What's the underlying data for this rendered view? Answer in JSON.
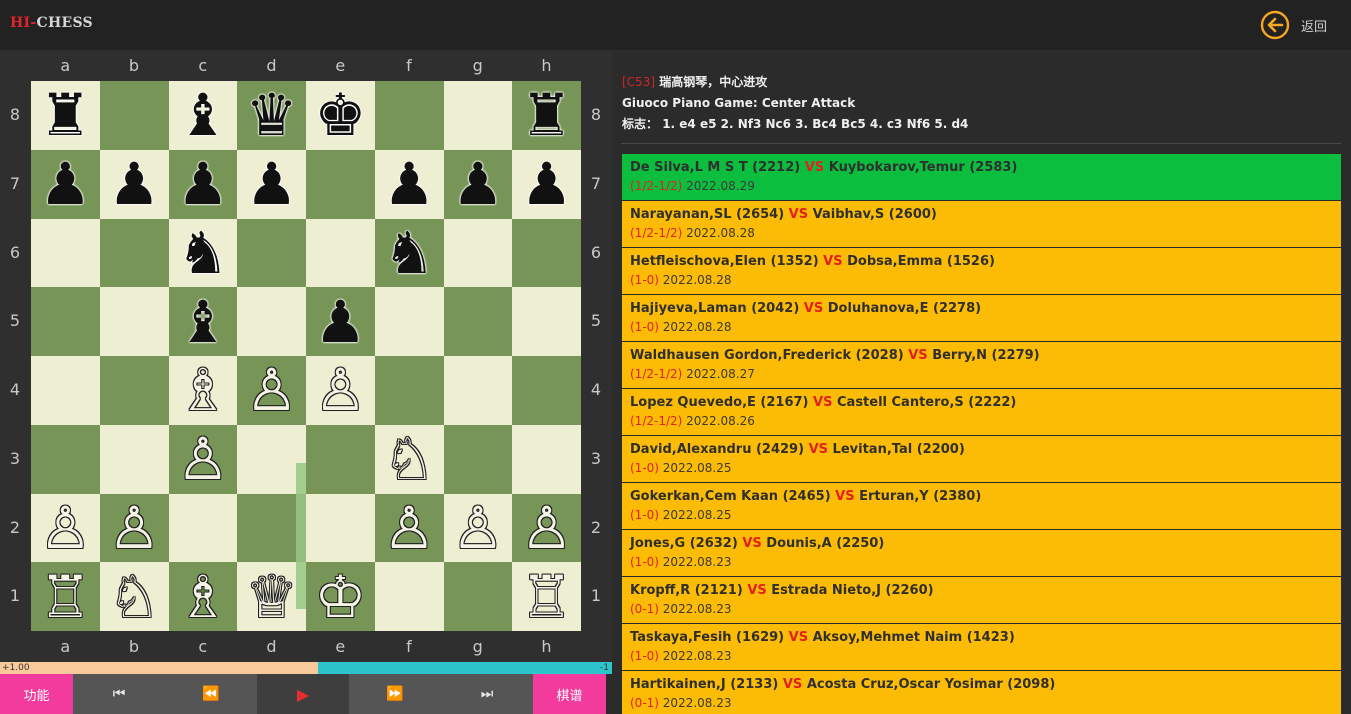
{
  "app": {
    "logo_hi": "HI",
    "logo_dash": "-",
    "logo_chess": "CHESS",
    "back_label": "返回"
  },
  "colors": {
    "accent": "#f5a623",
    "light_square": "#eeeed2",
    "dark_square": "#779556",
    "selected_row": "#0cbe3e",
    "row": "#fcbc05",
    "vs": "#e32020",
    "function_button": "#f23b9c"
  },
  "board": {
    "files": [
      "a",
      "b",
      "c",
      "d",
      "e",
      "f",
      "g",
      "h"
    ],
    "ranks": [
      "8",
      "7",
      "6",
      "5",
      "4",
      "3",
      "2",
      "1"
    ],
    "orientation": "white-bottom",
    "pieces": [
      {
        "square": "a8",
        "glyph": "♜",
        "color": "black",
        "name": "rook"
      },
      {
        "square": "c8",
        "glyph": "♝",
        "color": "black",
        "name": "bishop"
      },
      {
        "square": "d8",
        "glyph": "♛",
        "color": "black",
        "name": "queen"
      },
      {
        "square": "e8",
        "glyph": "♚",
        "color": "black",
        "name": "king"
      },
      {
        "square": "h8",
        "glyph": "♜",
        "color": "black",
        "name": "rook"
      },
      {
        "square": "a7",
        "glyph": "♟",
        "color": "black",
        "name": "pawn"
      },
      {
        "square": "b7",
        "glyph": "♟",
        "color": "black",
        "name": "pawn"
      },
      {
        "square": "c7",
        "glyph": "♟",
        "color": "black",
        "name": "pawn"
      },
      {
        "square": "d7",
        "glyph": "♟",
        "color": "black",
        "name": "pawn"
      },
      {
        "square": "f7",
        "glyph": "♟",
        "color": "black",
        "name": "pawn"
      },
      {
        "square": "g7",
        "glyph": "♟",
        "color": "black",
        "name": "pawn"
      },
      {
        "square": "h7",
        "glyph": "♟",
        "color": "black",
        "name": "pawn"
      },
      {
        "square": "c6",
        "glyph": "♞",
        "color": "black",
        "name": "knight"
      },
      {
        "square": "f6",
        "glyph": "♞",
        "color": "black",
        "name": "knight"
      },
      {
        "square": "c5",
        "glyph": "♝",
        "color": "black",
        "name": "bishop"
      },
      {
        "square": "e5",
        "glyph": "♟",
        "color": "black",
        "name": "pawn"
      },
      {
        "square": "c4",
        "glyph": "♗",
        "color": "white",
        "name": "bishop"
      },
      {
        "square": "d4",
        "glyph": "♙",
        "color": "white",
        "name": "pawn"
      },
      {
        "square": "e4",
        "glyph": "♙",
        "color": "white",
        "name": "pawn"
      },
      {
        "square": "c3",
        "glyph": "♙",
        "color": "white",
        "name": "pawn"
      },
      {
        "square": "f3",
        "glyph": "♘",
        "color": "white",
        "name": "knight"
      },
      {
        "square": "a2",
        "glyph": "♙",
        "color": "white",
        "name": "pawn"
      },
      {
        "square": "b2",
        "glyph": "♙",
        "color": "white",
        "name": "pawn"
      },
      {
        "square": "f2",
        "glyph": "♙",
        "color": "white",
        "name": "pawn"
      },
      {
        "square": "g2",
        "glyph": "♙",
        "color": "white",
        "name": "pawn"
      },
      {
        "square": "h2",
        "glyph": "♙",
        "color": "white",
        "name": "pawn"
      },
      {
        "square": "a1",
        "glyph": "♖",
        "color": "white",
        "name": "rook"
      },
      {
        "square": "b1",
        "glyph": "♘",
        "color": "white",
        "name": "knight"
      },
      {
        "square": "c1",
        "glyph": "♗",
        "color": "white",
        "name": "bishop"
      },
      {
        "square": "d1",
        "glyph": "♕",
        "color": "white",
        "name": "queen"
      },
      {
        "square": "e1",
        "glyph": "♔",
        "color": "white",
        "name": "king"
      },
      {
        "square": "h1",
        "glyph": "♖",
        "color": "white",
        "name": "rook"
      }
    ],
    "last_move": {
      "from": "d2",
      "to": "d4"
    }
  },
  "evaluation": {
    "left_label": "+1.00",
    "right_label": "-1",
    "white_share": 0.52
  },
  "controls": {
    "function_label": "功能",
    "record_label": "棋谱",
    "first_icon": "skip-to-start-icon",
    "prev_icon": "rewind-icon",
    "play_icon": "play-icon",
    "next_icon": "fast-forward-icon",
    "last_icon": "skip-to-end-icon",
    "first_glyph": "⏮",
    "prev_glyph": "⏪",
    "play_glyph": "▶",
    "next_glyph": "⏩",
    "last_glyph": "⏭"
  },
  "opening": {
    "eco": "[C53]",
    "name_cn": "瑞高钢琴，中心进攻",
    "name_en": "Giuoco Piano Game: Center Attack",
    "moves_label": "标志：",
    "moves": "1. e4 e5 2. Nf3 Nc6 3. Bc4 Bc5 4. c3 Nf6 5. d4"
  },
  "games": [
    {
      "white": "De Silva,L M S T (2212)",
      "black": "Kuybokarov,Temur (2583)",
      "result": "(1/2-1/2)",
      "date": "2022.08.29",
      "selected": true
    },
    {
      "white": "Narayanan,SL (2654)",
      "black": "Vaibhav,S (2600)",
      "result": "(1/2-1/2)",
      "date": "2022.08.28",
      "selected": false
    },
    {
      "white": "Hetfleischova,Elen (1352)",
      "black": "Dobsa,Emma (1526)",
      "result": "(1-0)",
      "date": "2022.08.28",
      "selected": false
    },
    {
      "white": "Hajiyeva,Laman (2042)",
      "black": "Doluhanova,E (2278)",
      "result": "(1-0)",
      "date": "2022.08.28",
      "selected": false
    },
    {
      "white": "Waldhausen Gordon,Frederick (2028)",
      "black": "Berry,N (2279)",
      "result": "(1/2-1/2)",
      "date": "2022.08.27",
      "selected": false
    },
    {
      "white": "Lopez Quevedo,E (2167)",
      "black": "Castell Cantero,S (2222)",
      "result": "(1/2-1/2)",
      "date": "2022.08.26",
      "selected": false
    },
    {
      "white": "David,Alexandru (2429)",
      "black": "Levitan,Tal (2200)",
      "result": "(1-0)",
      "date": "2022.08.25",
      "selected": false
    },
    {
      "white": "Gokerkan,Cem Kaan (2465)",
      "black": "Erturan,Y (2380)",
      "result": "(1-0)",
      "date": "2022.08.25",
      "selected": false
    },
    {
      "white": "Jones,G (2632)",
      "black": "Dounis,A (2250)",
      "result": "(1-0)",
      "date": "2022.08.23",
      "selected": false
    },
    {
      "white": "Kropff,R (2121)",
      "black": "Estrada Nieto,J (2260)",
      "result": "(0-1)",
      "date": "2022.08.23",
      "selected": false
    },
    {
      "white": "Taskaya,Fesih (1629)",
      "black": "Aksoy,Mehmet Naim (1423)",
      "result": "(1-0)",
      "date": "2022.08.23",
      "selected": false
    },
    {
      "white": "Hartikainen,J (2133)",
      "black": "Acosta Cruz,Oscar Yosimar (2098)",
      "result": "(0-1)",
      "date": "2022.08.23",
      "selected": false
    }
  ],
  "vs_label": "VS"
}
